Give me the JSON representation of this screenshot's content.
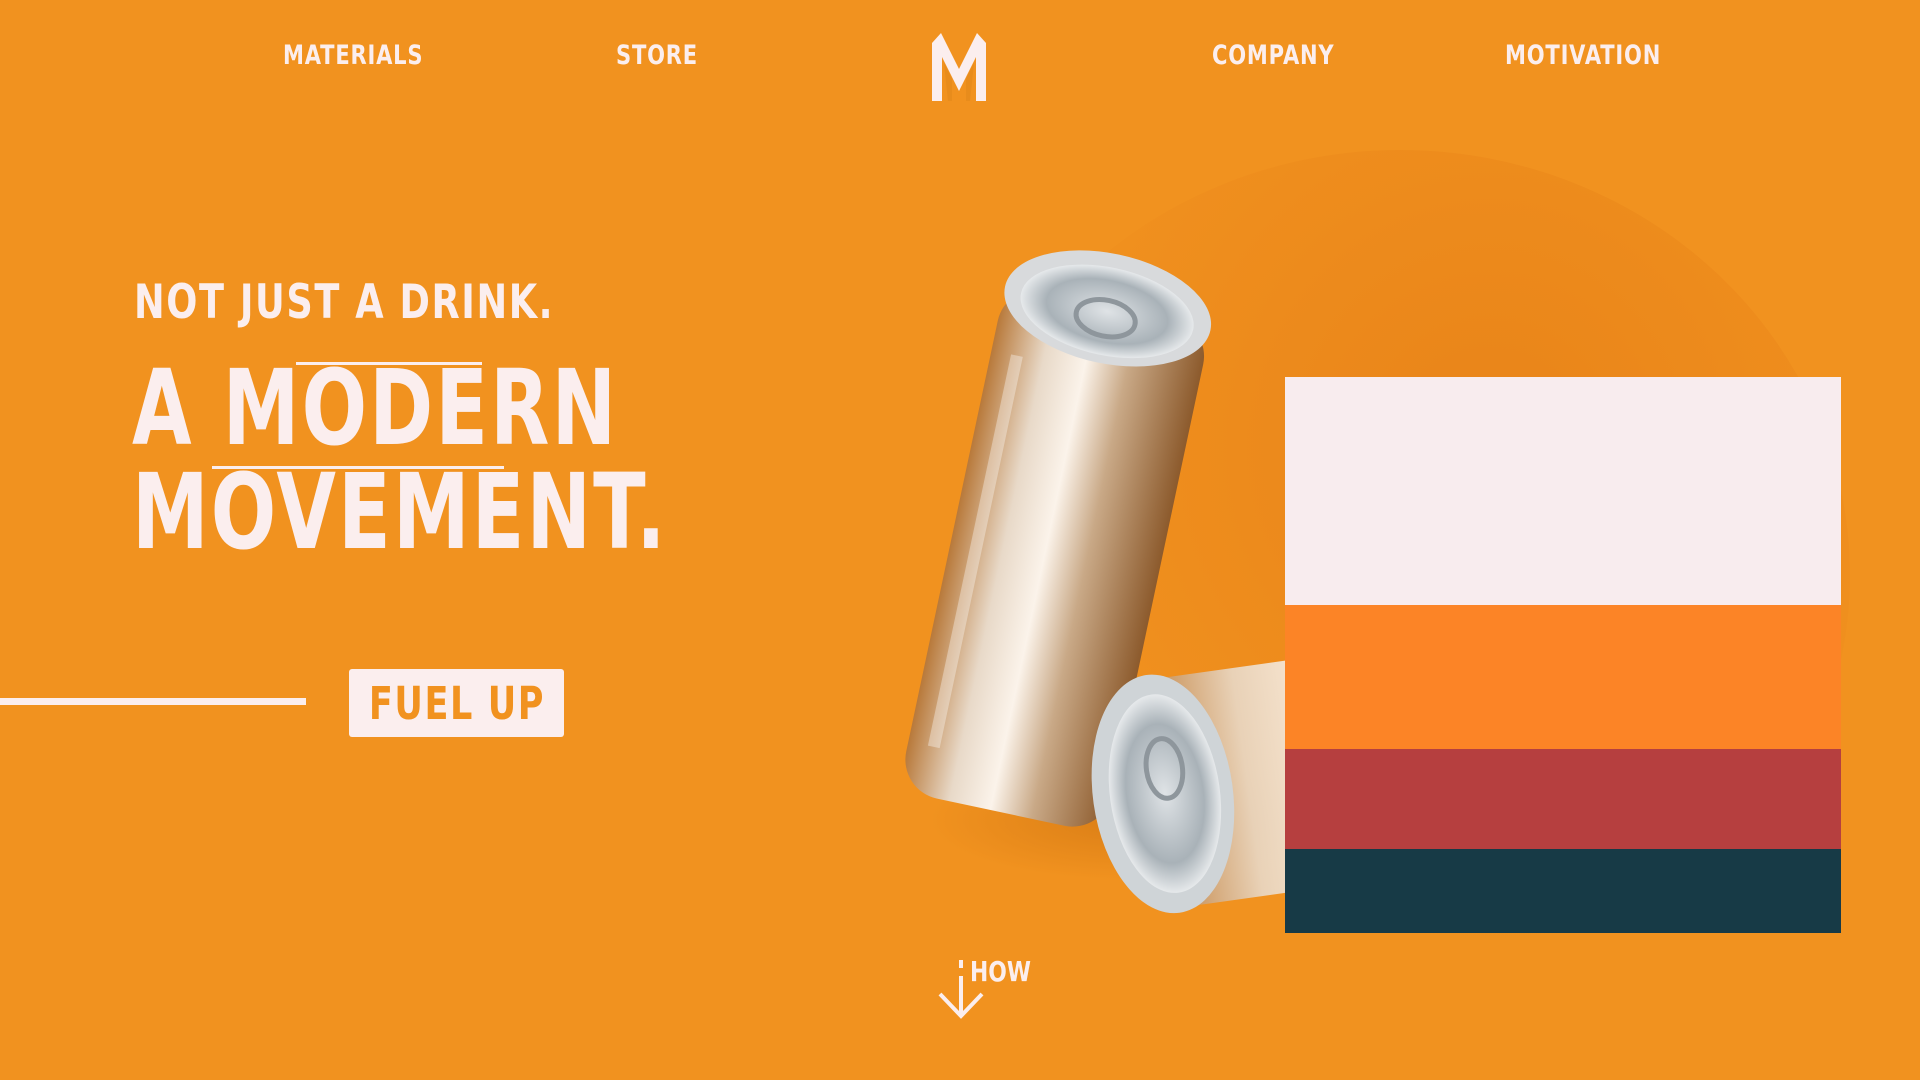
{
  "nav": {
    "items": [
      {
        "label": "MATERIALS"
      },
      {
        "label": "STORE"
      },
      {
        "label": "COMPANY"
      },
      {
        "label": "MOTIVATION"
      }
    ],
    "logo_letter": "M"
  },
  "hero": {
    "tagline": "NOT JUST A DRINK.",
    "headline_line1": "A MODERN",
    "headline_line2": "MOVEMENT.",
    "cta_label": "FUEL UP"
  },
  "scroll_hint": {
    "label": "HOW",
    "icon": "arrow-down-icon"
  },
  "palette": {
    "swatches": [
      "#f8ecee",
      "#fc8426",
      "#b63f3f",
      "#173a46"
    ]
  },
  "colors": {
    "background": "#f1921f",
    "text": "#fbeeee"
  }
}
